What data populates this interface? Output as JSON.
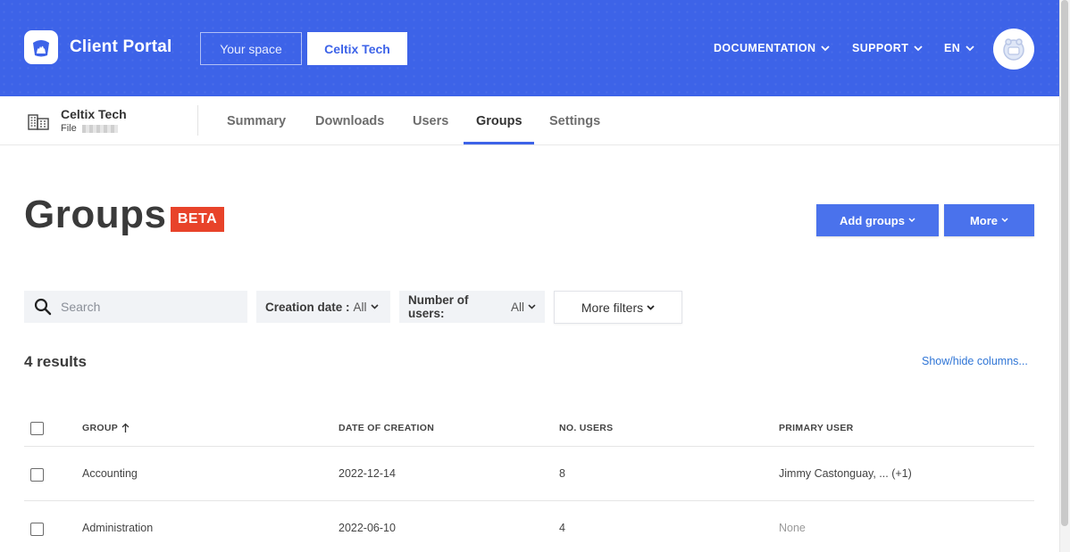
{
  "header": {
    "app_title": "Client Portal",
    "your_space_label": "Your space",
    "company_label": "Celtix Tech",
    "documentation_label": "DOCUMENTATION",
    "support_label": "SUPPORT",
    "language_label": "EN",
    "brand_color": "#3d63e8"
  },
  "org": {
    "name": "Celtix Tech",
    "file_label": "File"
  },
  "tabs": [
    {
      "label": "Summary",
      "active": false
    },
    {
      "label": "Downloads",
      "active": false
    },
    {
      "label": "Users",
      "active": false
    },
    {
      "label": "Groups",
      "active": true
    },
    {
      "label": "Settings",
      "active": false
    }
  ],
  "page": {
    "title": "Groups",
    "badge": "BETA",
    "badge_color": "#e8432a",
    "add_groups_label": "Add groups",
    "more_label": "More"
  },
  "filters": {
    "search_placeholder": "Search",
    "creation_date_label": "Creation date :",
    "creation_date_value": "All",
    "number_users_label": "Number of users:",
    "number_users_value": "All",
    "more_filters_label": "More filters"
  },
  "results": {
    "count_label": "4 results",
    "show_hide_label": "Show/hide columns..."
  },
  "table": {
    "columns": [
      "GROUP",
      "DATE OF CREATION",
      "NO. USERS",
      "PRIMARY USER"
    ],
    "rows": [
      {
        "group": "Accounting",
        "date": "2022-12-14",
        "users": "8",
        "primary": "Jimmy Castonguay, ... (+1)"
      },
      {
        "group": "Administration",
        "date": "2022-06-10",
        "users": "4",
        "primary": "None"
      }
    ]
  }
}
